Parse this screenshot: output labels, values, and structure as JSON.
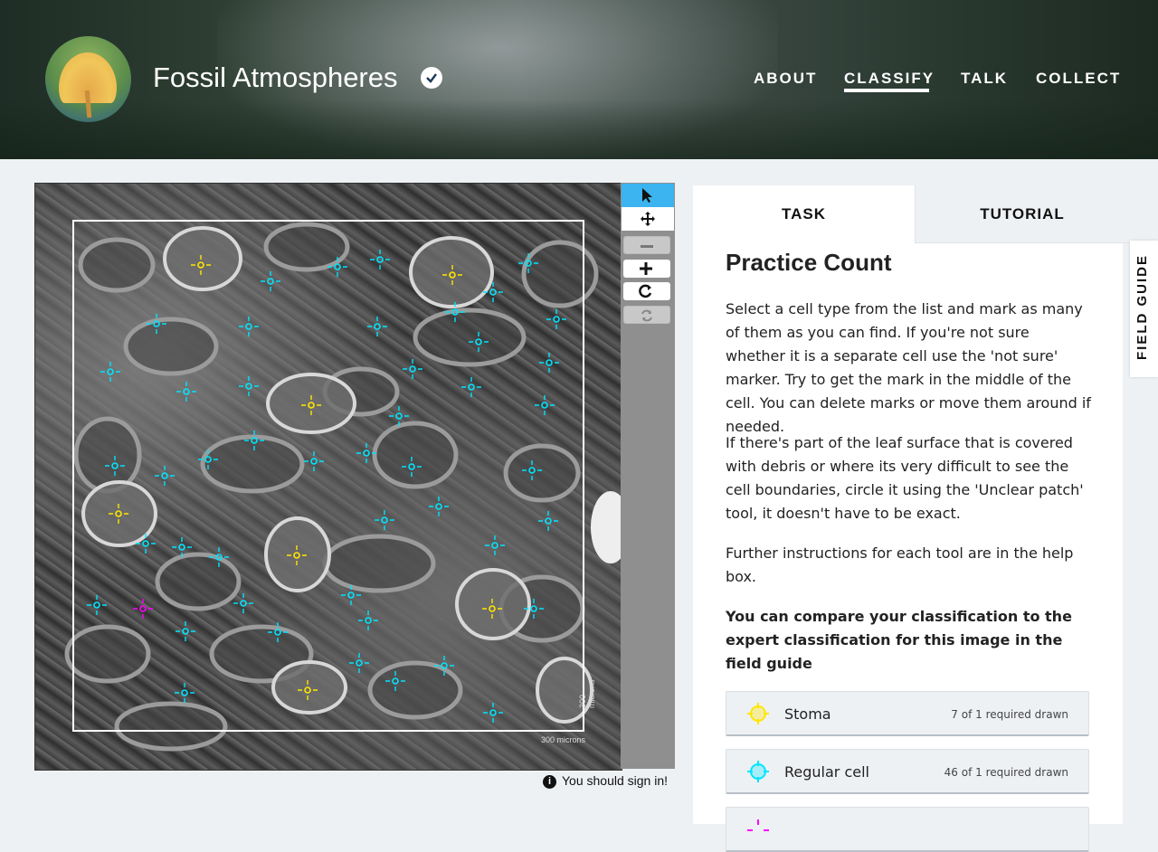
{
  "header": {
    "site_title": "Fossil Atmospheres",
    "nav": [
      "ABOUT",
      "CLASSIFY",
      "TALK",
      "COLLECT"
    ],
    "active_nav": "CLASSIFY"
  },
  "image_viewer": {
    "scale_label": "300 microns",
    "tools": [
      "select-icon",
      "move-icon",
      "zoom-out-icon",
      "zoom-in-icon",
      "rotate-icon",
      "reset-icon"
    ],
    "marks": {
      "stoma_count": 7,
      "regular_cell_count": 46,
      "colors": {
        "stoma": "#ffe600",
        "regular_cell": "#00e5ff",
        "not_sure": "#ff00ff"
      }
    }
  },
  "signin_text": "You should sign in!",
  "task": {
    "tabs": [
      "TASK",
      "TUTORIAL"
    ],
    "title": "Practice Count",
    "p1": "Select a cell type from the list and mark as many of them as you can find. If you're not sure whether it is a separate cell use the 'not sure' marker. Try to get the mark in the middle of the cell. You can delete marks or move them around if needed.",
    "p2": "If there's part of the leaf surface that is covered with debris or where its very difficult to see the cell boundaries, circle it using the 'Unclear patch' tool, it doesn't have to be exact.",
    "p3": "Further instructions for each tool are in the help box.",
    "p4": "You can compare your classification to the expert classification for this image in the field guide",
    "answers": [
      {
        "label": "Stoma",
        "count": "7 of 1 required drawn",
        "color": "#ffe600"
      },
      {
        "label": "Regular cell",
        "count": "46 of 1 required drawn",
        "color": "#00e5ff"
      }
    ]
  },
  "field_guide_label": "FIELD GUIDE"
}
